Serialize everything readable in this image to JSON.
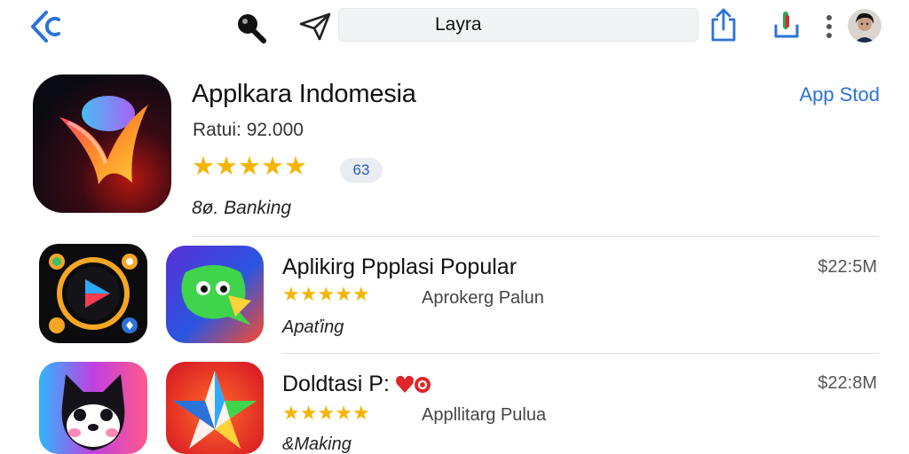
{
  "topbar": {
    "search_value": "Layra",
    "icons": [
      "back-icon",
      "pin-icon",
      "send-icon",
      "share-icon",
      "mic-icon",
      "more-icon",
      "avatar"
    ]
  },
  "featured": {
    "title": "Applkara Indomesia",
    "store_link": "App Stod",
    "rating_text": "Ratui: 92.000",
    "rating": 4.5,
    "badge": "63",
    "category": "8ø. Banking"
  },
  "list": [
    {
      "title": "Aplikirg Ppplasi Popular",
      "price": "$22:5M",
      "rating": 4.5,
      "subtitle": "Aprokerg Palun",
      "category": "Apaťing"
    },
    {
      "title": "Doldtasi P:",
      "price": "$22:8M",
      "rating": 4.5,
      "subtitle": "Appllitarg Pulua",
      "category": "&Making"
    }
  ],
  "colors": {
    "accent": "#2a73d8",
    "star": "#f4b400",
    "star_empty": "#c9c9c9",
    "heart": "#e0262a"
  }
}
